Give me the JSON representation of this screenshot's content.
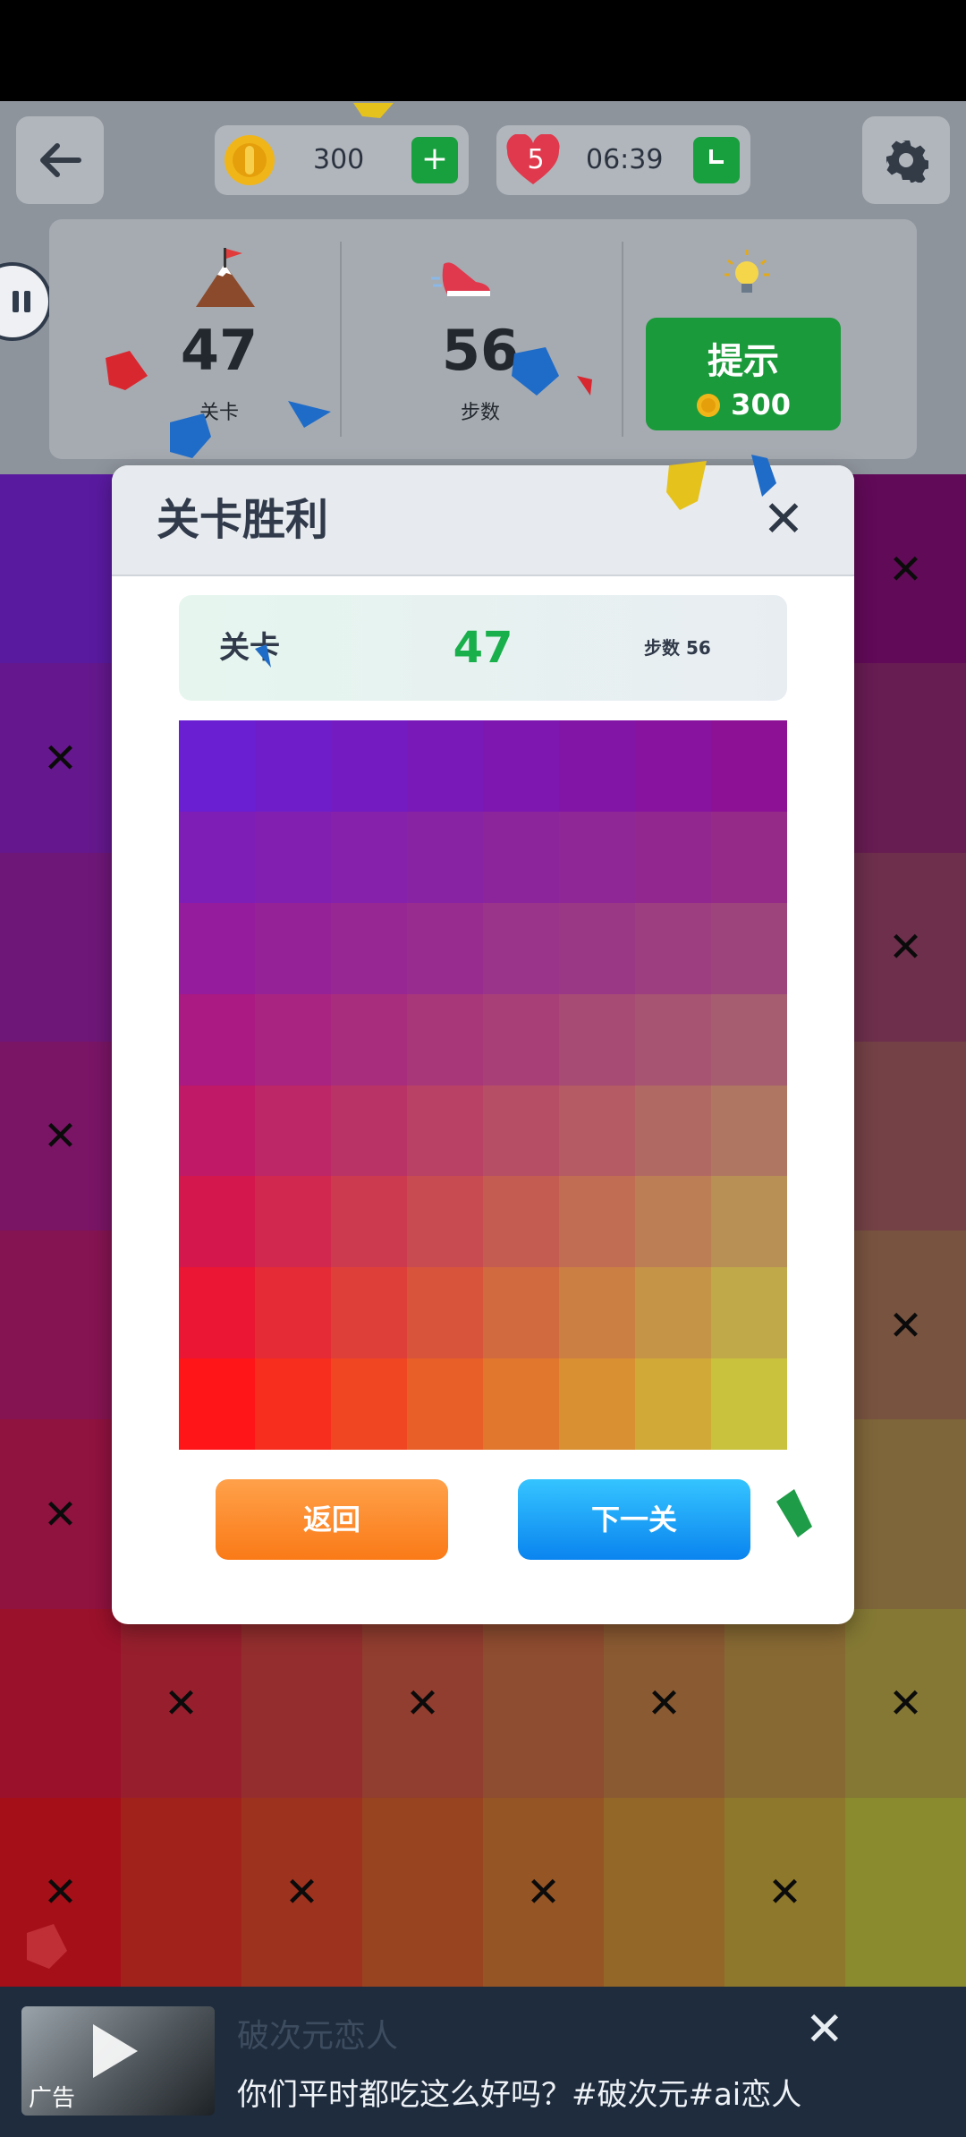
{
  "header": {
    "coins": "300",
    "lives": "5",
    "timer": "06:39"
  },
  "stats": {
    "level_value": "47",
    "level_label": "关卡",
    "steps_value": "56",
    "steps_label": "步数",
    "hint_label": "提示",
    "hint_cost": "300"
  },
  "modal": {
    "title": "关卡胜利",
    "level_label": "关卡",
    "level_value": "47",
    "steps_text": "步数 56",
    "back_label": "返回",
    "next_label": "下一关"
  },
  "ad": {
    "tag": "广告",
    "title": "破次元恋人",
    "description": "你们平时都吃这么好吗？#破次元#ai恋人"
  },
  "board": {
    "top_left": "#5a1aa0",
    "top_right": "#610a58",
    "bottom_left": "#a50f18",
    "bottom_right": "#8a8a2e",
    "marked_cells": [
      [
        0,
        7
      ],
      [
        1,
        0
      ],
      [
        2,
        7
      ],
      [
        3,
        0
      ],
      [
        4,
        7
      ],
      [
        5,
        0
      ],
      [
        6,
        1
      ],
      [
        6,
        3
      ],
      [
        6,
        5
      ],
      [
        6,
        7
      ],
      [
        7,
        0
      ],
      [
        7,
        2
      ],
      [
        7,
        4
      ],
      [
        7,
        6
      ]
    ]
  },
  "preview": {
    "top_left": "#6a1fd2",
    "top_right": "#8c1195",
    "bottom_left": "#ff1418",
    "bottom_right": "#c9c23c"
  },
  "colors": {
    "green": "#1a9a3a",
    "win_number": "#19b04c",
    "orange": "#fa7a17",
    "blue": "#0a84ef"
  }
}
